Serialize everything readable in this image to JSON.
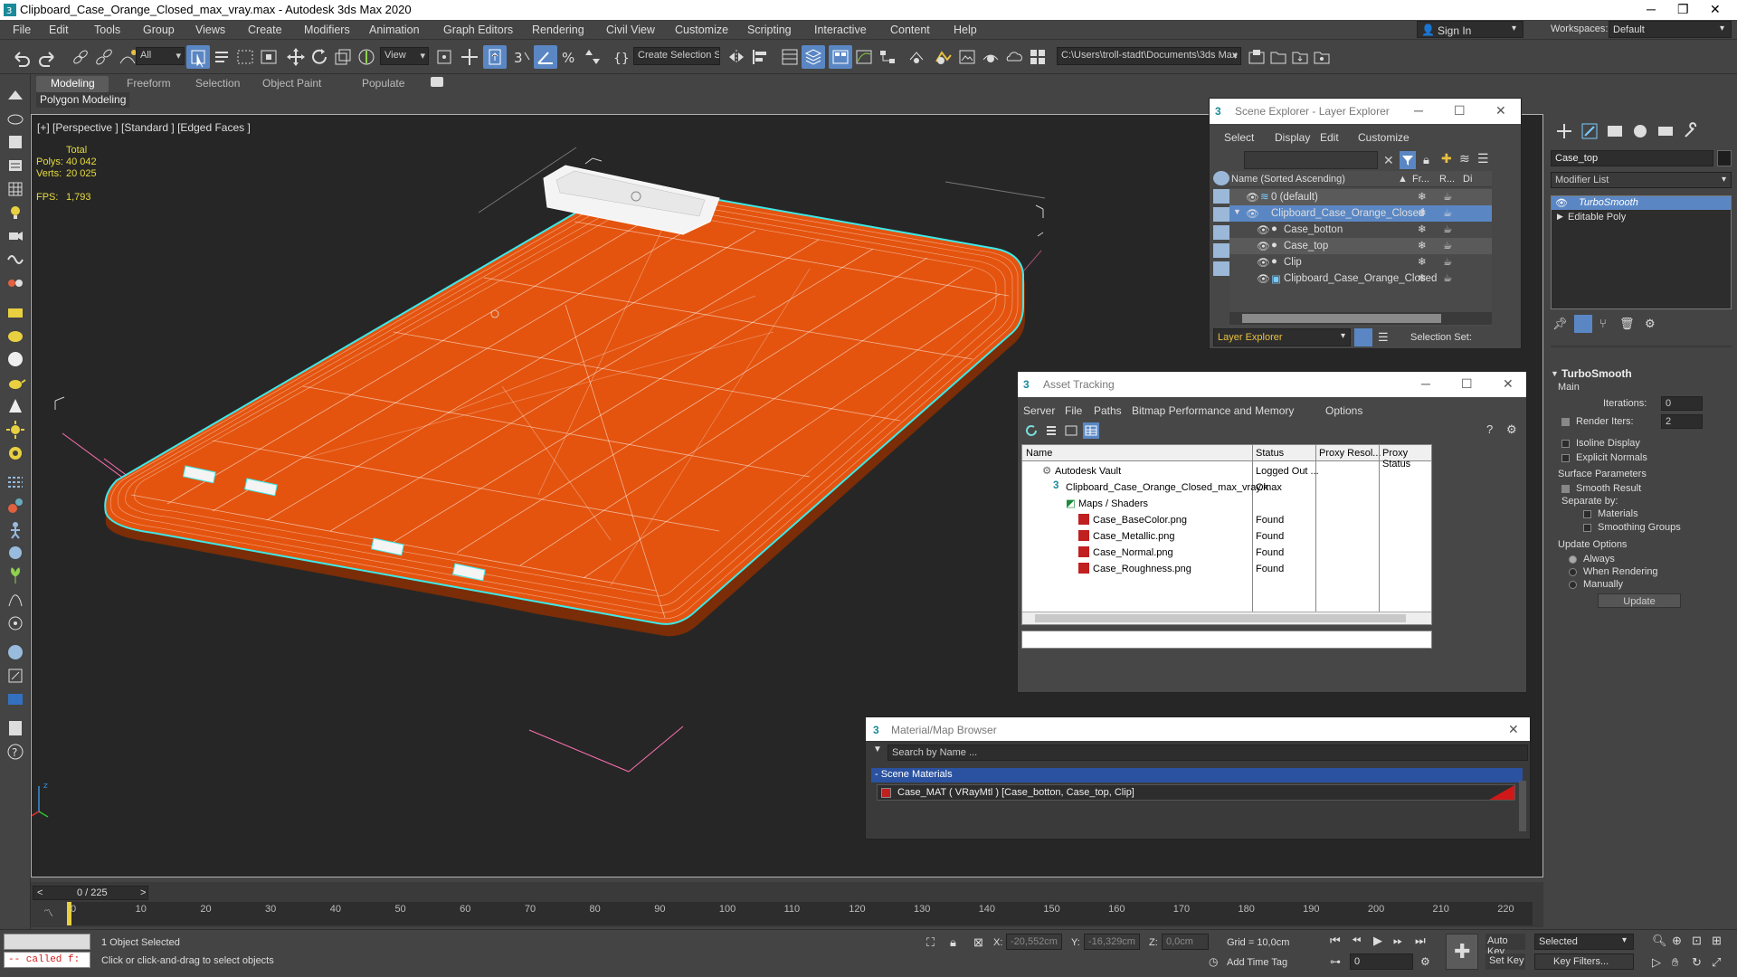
{
  "window": {
    "title": "Clipboard_Case_Orange_Closed_max_vray.max - Autodesk 3ds Max 2020"
  },
  "menu": [
    "File",
    "Edit",
    "Tools",
    "Group",
    "Views",
    "Create",
    "Modifiers",
    "Animation",
    "Graph Editors",
    "Rendering",
    "Civil View",
    "Customize",
    "Scripting",
    "Interactive",
    "Content",
    "Help"
  ],
  "account": {
    "sign_in": "Sign In",
    "workspaces_label": "Workspaces:",
    "workspace": "Default"
  },
  "toolbar": {
    "filter": "All",
    "ref_coord": "View",
    "selection_set": "Create Selection Se",
    "path": "C:\\Users\\troll-stadt\\Documents\\3ds Max 2020"
  },
  "ribbon": {
    "tabs": [
      "Modeling",
      "Freeform",
      "Selection",
      "Object Paint",
      "Populate"
    ],
    "active": "Modeling",
    "panel": "Polygon Modeling"
  },
  "viewport": {
    "label": "[+] [Perspective ] [Standard ] [Edged Faces ]",
    "stats": {
      "total_label": "Total",
      "polys_label": "Polys:",
      "polys": "40 042",
      "verts_label": "Verts:",
      "verts": "20 025",
      "fps_label": "FPS:",
      "fps": "1,793"
    },
    "object_color": "#e4540f",
    "selection_color": "#3ee8e8"
  },
  "scene_explorer": {
    "title": "Scene Explorer - Layer Explorer",
    "menu": [
      "Select",
      "Display",
      "Edit",
      "Customize"
    ],
    "columns": [
      "Name (Sorted Ascending)",
      "Fr...",
      "R...",
      "Di"
    ],
    "rows": [
      {
        "name": "0 (default)",
        "indent": 1
      },
      {
        "name": "Clipboard_Case_Orange_Closed",
        "indent": 1
      },
      {
        "name": "Case_botton",
        "indent": 2
      },
      {
        "name": "Case_top",
        "indent": 2
      },
      {
        "name": "Clip",
        "indent": 2
      },
      {
        "name": "Clipboard_Case_Orange_Closed",
        "indent": 2
      }
    ],
    "footer_dropdown": "Layer Explorer",
    "footer_label": "Selection Set:"
  },
  "asset_tracking": {
    "title": "Asset Tracking",
    "menu": [
      "Server",
      "File",
      "Paths",
      "Bitmap Performance and Memory",
      "Options"
    ],
    "columns": [
      "Name",
      "Status",
      "Proxy Resol...",
      "Proxy Status"
    ],
    "rows": [
      {
        "name": "Autodesk Vault",
        "status": "Logged Out ...",
        "indent": 1
      },
      {
        "name": "Clipboard_Case_Orange_Closed_max_vray.max",
        "status": "Ok",
        "indent": 2
      },
      {
        "name": "Maps / Shaders",
        "status": "",
        "indent": 3
      },
      {
        "name": "Case_BaseColor.png",
        "status": "Found",
        "indent": 4
      },
      {
        "name": "Case_Metallic.png",
        "status": "Found",
        "indent": 4
      },
      {
        "name": "Case_Normal.png",
        "status": "Found",
        "indent": 4
      },
      {
        "name": "Case_Roughness.png",
        "status": "Found",
        "indent": 4
      }
    ]
  },
  "material_browser": {
    "title": "Material/Map Browser",
    "search_placeholder": "Search by Name ...",
    "group": "- Scene Materials",
    "item": "Case_MAT ( VRayMtl ) [Case_botton, Case_top, Clip]"
  },
  "command_panel": {
    "object_name": "Case_top",
    "modifier_list": "Modifier List",
    "stack": [
      "TurboSmooth",
      "Editable Poly"
    ],
    "rollout": "TurboSmooth",
    "main": "Main",
    "iterations_label": "Iterations:",
    "iterations": "0",
    "render_iters_label": "Render Iters:",
    "render_iters": "2",
    "isoline": "Isoline Display",
    "explicit_normals": "Explicit Normals",
    "surface_params": "Surface Parameters",
    "smooth_result": "Smooth Result",
    "separate_by": "Separate by:",
    "materials": "Materials",
    "smoothing_groups": "Smoothing Groups",
    "update_options": "Update Options",
    "always": "Always",
    "when_rendering": "When Rendering",
    "manually": "Manually",
    "update_button": "Update"
  },
  "timeline": {
    "frame": "0 / 225",
    "ticks": [
      "0",
      "10",
      "20",
      "30",
      "40",
      "50",
      "60",
      "70",
      "80",
      "90",
      "100",
      "110",
      "120",
      "130",
      "140",
      "150",
      "160",
      "170",
      "180",
      "190",
      "200",
      "210",
      "220"
    ],
    "progress": 0.0
  },
  "status": {
    "maxscript": "-- called f:",
    "selected": "1 Object Selected",
    "prompt": "Click or click-and-drag to select objects",
    "x_label": "X:",
    "x": "-20,552cm",
    "y_label": "Y:",
    "y": "-16,329cm",
    "z_label": "Z:",
    "z": "0,0cm",
    "grid": "Grid = 10,0cm",
    "add_time_tag": "Add Time Tag",
    "auto_key": "Auto Key",
    "set_key": "Set Key",
    "key_mode": "Selected",
    "key_filters": "Key Filters...",
    "frame_field": "0"
  }
}
